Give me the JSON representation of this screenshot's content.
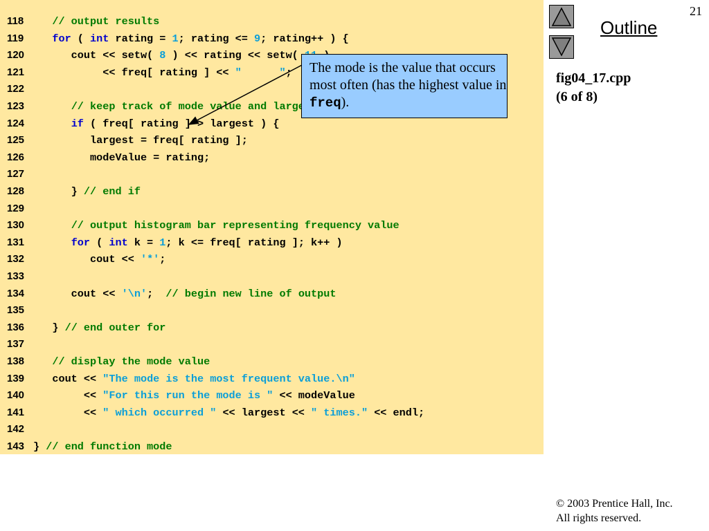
{
  "slide": {
    "number": "21",
    "outline_label": "Outline",
    "file_name": "fig04_17.cpp",
    "page_info": "(6 of 8)",
    "copyright_line1": "© 2003 Prentice Hall, Inc.",
    "copyright_line2": "All rights reserved."
  },
  "navigation": {
    "up_icon": "triangle-up-icon",
    "down_icon": "triangle-down-icon"
  },
  "callout": {
    "text_before": "The mode is the value that occurs most often (has the highest value in ",
    "code_term": "freq",
    "text_after": ")."
  },
  "colors": {
    "code_background": "#ffe8a0",
    "comment": "#007a00",
    "keyword": "#0000cc",
    "literal": "#0a9ed8",
    "callout_background": "#99ccff"
  },
  "code_lines": [
    {
      "num": "118",
      "tokens": [
        [
          "p",
          "   "
        ],
        [
          "c",
          "// output results"
        ]
      ]
    },
    {
      "num": "119",
      "tokens": [
        [
          "p",
          "   "
        ],
        [
          "k",
          "for"
        ],
        [
          "p",
          " ( "
        ],
        [
          "k",
          "int"
        ],
        [
          "p",
          " rating = "
        ],
        [
          "n",
          "1"
        ],
        [
          "p",
          "; rating <= "
        ],
        [
          "n",
          "9"
        ],
        [
          "p",
          "; rating++ ) {"
        ]
      ]
    },
    {
      "num": "120",
      "tokens": [
        [
          "p",
          "      cout << setw( "
        ],
        [
          "n",
          "8"
        ],
        [
          "p",
          " ) << rating << setw( "
        ],
        [
          "n",
          "11"
        ],
        [
          "p",
          " )"
        ]
      ]
    },
    {
      "num": "121",
      "tokens": [
        [
          "p",
          "           << freq[ rating ] << "
        ],
        [
          "s",
          "\"      \""
        ],
        [
          "p",
          ";"
        ]
      ]
    },
    {
      "num": "122",
      "tokens": []
    },
    {
      "num": "123",
      "tokens": [
        [
          "p",
          "      "
        ],
        [
          "c",
          "// keep track of mode value and largest fequency value"
        ]
      ]
    },
    {
      "num": "124",
      "tokens": [
        [
          "p",
          "      "
        ],
        [
          "k",
          "if"
        ],
        [
          "p",
          " ( freq[ rating ] > largest ) {"
        ]
      ]
    },
    {
      "num": "125",
      "tokens": [
        [
          "p",
          "         largest = freq[ rating ];"
        ]
      ]
    },
    {
      "num": "126",
      "tokens": [
        [
          "p",
          "         modeValue = rating;"
        ]
      ]
    },
    {
      "num": "127",
      "tokens": []
    },
    {
      "num": "128",
      "tokens": [
        [
          "p",
          "      } "
        ],
        [
          "c",
          "// end if"
        ]
      ]
    },
    {
      "num": "129",
      "tokens": []
    },
    {
      "num": "130",
      "tokens": [
        [
          "p",
          "      "
        ],
        [
          "c",
          "// output histogram bar representing frequency value"
        ]
      ]
    },
    {
      "num": "131",
      "tokens": [
        [
          "p",
          "      "
        ],
        [
          "k",
          "for"
        ],
        [
          "p",
          " ( "
        ],
        [
          "k",
          "int"
        ],
        [
          "p",
          " k = "
        ],
        [
          "n",
          "1"
        ],
        [
          "p",
          "; k <= freq[ rating ]; k++ )"
        ]
      ]
    },
    {
      "num": "132",
      "tokens": [
        [
          "p",
          "         cout << "
        ],
        [
          "s",
          "'*'"
        ],
        [
          "p",
          ";"
        ]
      ]
    },
    {
      "num": "133",
      "tokens": []
    },
    {
      "num": "134",
      "tokens": [
        [
          "p",
          "      cout << "
        ],
        [
          "s",
          "'\\n'"
        ],
        [
          "p",
          ";  "
        ],
        [
          "c",
          "// begin new line of output"
        ]
      ]
    },
    {
      "num": "135",
      "tokens": []
    },
    {
      "num": "136",
      "tokens": [
        [
          "p",
          "   } "
        ],
        [
          "c",
          "// end outer for"
        ]
      ]
    },
    {
      "num": "137",
      "tokens": []
    },
    {
      "num": "138",
      "tokens": [
        [
          "p",
          "   "
        ],
        [
          "c",
          "// display the mode value"
        ]
      ]
    },
    {
      "num": "139",
      "tokens": [
        [
          "p",
          "   cout << "
        ],
        [
          "s",
          "\"The mode is the most frequent value.\\n\""
        ]
      ]
    },
    {
      "num": "140",
      "tokens": [
        [
          "p",
          "        << "
        ],
        [
          "s",
          "\"For this run the mode is \""
        ],
        [
          "p",
          " << modeValue"
        ]
      ]
    },
    {
      "num": "141",
      "tokens": [
        [
          "p",
          "        << "
        ],
        [
          "s",
          "\" which occurred \""
        ],
        [
          "p",
          " << largest << "
        ],
        [
          "s",
          "\" times.\""
        ],
        [
          "p",
          " << endl;"
        ]
      ]
    },
    {
      "num": "142",
      "tokens": []
    },
    {
      "num": "143",
      "tokens": [
        [
          "p",
          "} "
        ],
        [
          "c",
          "// end function mode"
        ]
      ]
    }
  ]
}
